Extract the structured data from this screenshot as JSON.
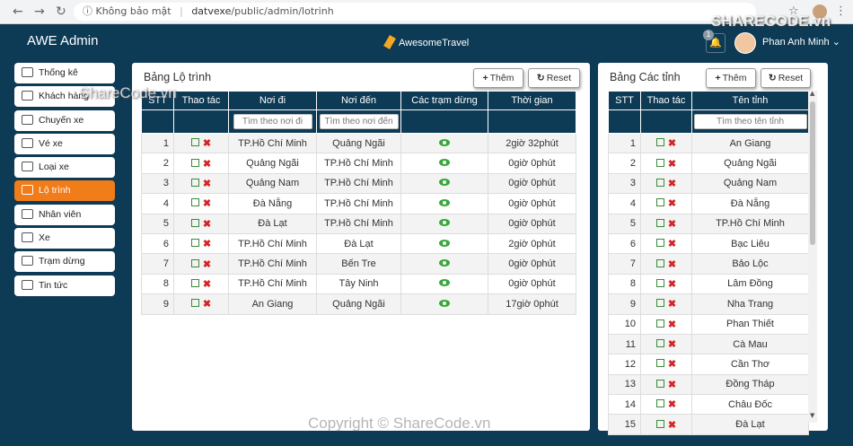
{
  "browser": {
    "security_label": "Không bảo mật",
    "url_host": "datvexe",
    "url_path": "/public/admin/lotrinh"
  },
  "topnav": {
    "brand": "AWE Admin",
    "logo_text": "AwesomeTravel",
    "user_name": "Phan Anh Minh",
    "notification_count": "1"
  },
  "sidebar": {
    "items": [
      {
        "label": "Thống kê"
      },
      {
        "label": "Khách hàng"
      },
      {
        "label": "Chuyến xe"
      },
      {
        "label": "Vé xe"
      },
      {
        "label": "Loại xe"
      },
      {
        "label": "Lộ trình"
      },
      {
        "label": "Nhân viên"
      },
      {
        "label": "Xe"
      },
      {
        "label": "Trạm dừng"
      },
      {
        "label": "Tin tức"
      }
    ],
    "active_index": 5
  },
  "routes_panel": {
    "title": "Bảng Lộ trình",
    "add_label": "Thêm",
    "reset_label": "Reset",
    "headers": [
      "STT",
      "Thao tác",
      "Nơi đi",
      "Nơi đến",
      "Các trạm dừng",
      "Thời gian"
    ],
    "filter_placeholders": [
      "Tìm theo nơi đi",
      "Tìm theo nơi đến"
    ],
    "rows": [
      {
        "stt": "1",
        "from": "TP.Hồ Chí Minh",
        "to": "Quảng Ngãi",
        "time": "2giờ 32phút"
      },
      {
        "stt": "2",
        "from": "Quảng Ngãi",
        "to": "TP.Hồ Chí Minh",
        "time": "0giờ 0phút"
      },
      {
        "stt": "3",
        "from": "Quảng Nam",
        "to": "TP.Hồ Chí Minh",
        "time": "0giờ 0phút"
      },
      {
        "stt": "4",
        "from": "Đà Nẵng",
        "to": "TP.Hồ Chí Minh",
        "time": "0giờ 0phút"
      },
      {
        "stt": "5",
        "from": "Đà Lạt",
        "to": "TP.Hồ Chí Minh",
        "time": "0giờ 0phút"
      },
      {
        "stt": "6",
        "from": "TP.Hồ Chí Minh",
        "to": "Đà Lạt",
        "time": "2giờ 0phút"
      },
      {
        "stt": "7",
        "from": "TP.Hồ Chí Minh",
        "to": "Bến Tre",
        "time": "0giờ 0phút"
      },
      {
        "stt": "8",
        "from": "TP.Hồ Chí Minh",
        "to": "Tây Ninh",
        "time": "0giờ 0phút"
      },
      {
        "stt": "9",
        "from": "An Giang",
        "to": "Quảng Ngãi",
        "time": "17giờ 0phút"
      }
    ]
  },
  "provinces_panel": {
    "title": "Bảng Các tỉnh",
    "add_label": "Thêm",
    "reset_label": "Reset",
    "headers": [
      "STT",
      "Thao tác",
      "Tên tỉnh"
    ],
    "filter_placeholder": "Tìm theo tên tỉnh",
    "rows": [
      {
        "stt": "1",
        "name": "An Giang"
      },
      {
        "stt": "2",
        "name": "Quảng Ngãi"
      },
      {
        "stt": "3",
        "name": "Quảng Nam"
      },
      {
        "stt": "4",
        "name": "Đà Nẵng"
      },
      {
        "stt": "5",
        "name": "TP.Hồ Chí Minh"
      },
      {
        "stt": "6",
        "name": "Bạc Liêu"
      },
      {
        "stt": "7",
        "name": "Bảo Lộc"
      },
      {
        "stt": "8",
        "name": "Lâm Đồng"
      },
      {
        "stt": "9",
        "name": "Nha Trang"
      },
      {
        "stt": "10",
        "name": "Phan Thiết"
      },
      {
        "stt": "11",
        "name": "Cà Mau"
      },
      {
        "stt": "12",
        "name": "Cần Thơ"
      },
      {
        "stt": "13",
        "name": "Đồng Tháp"
      },
      {
        "stt": "14",
        "name": "Châu Đốc"
      },
      {
        "stt": "15",
        "name": "Đà Lạt"
      }
    ]
  },
  "watermarks": {
    "top": "ShareCode.vn",
    "bottom": "Copyright © ShareCode.vn",
    "logo": "SHARECODE.vn"
  },
  "colors": {
    "navy": "#0d3a55",
    "orange": "#f07c1a",
    "eye_green": "#38a838",
    "delete_red": "#d62424"
  }
}
